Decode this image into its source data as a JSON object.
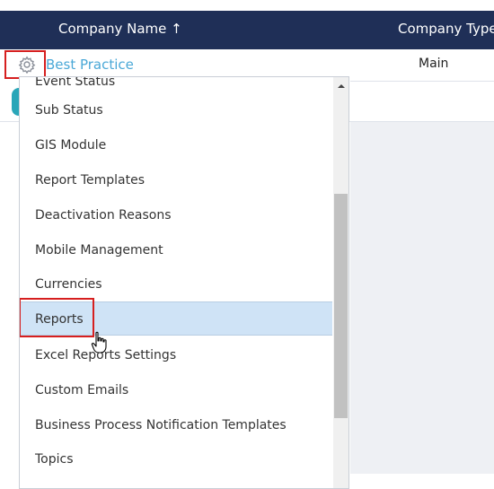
{
  "table": {
    "headers": {
      "company_name": "Company Name ↑",
      "company_type": "Company Type"
    },
    "row": {
      "company_name": "Best Practice",
      "company_type": "Main"
    }
  },
  "menu": {
    "partial_item": "Event Status",
    "items": [
      "Sub Status",
      "GIS Module",
      "Report Templates",
      "Deactivation Reasons",
      "Mobile Management",
      "Currencies",
      "Reports",
      "Excel Reports Settings",
      "Custom Emails",
      "Business Process Notification Templates",
      "Topics"
    ],
    "highlighted": "Reports"
  },
  "colors": {
    "header_bg": "#1f2f57",
    "link": "#4aa8d7",
    "highlight": "#cfe3f6",
    "annotation": "#d61f1f",
    "teal": "#2aa6b8"
  }
}
